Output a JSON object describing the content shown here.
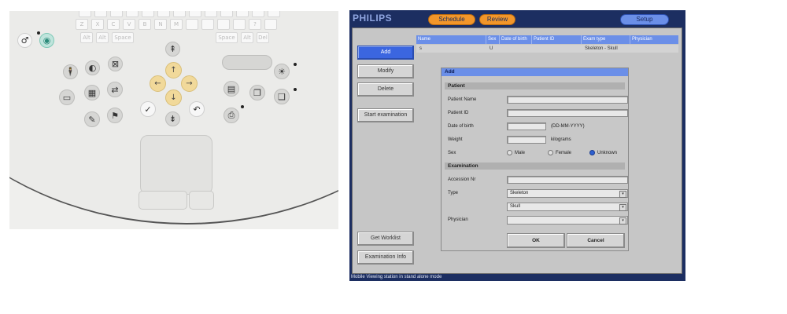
{
  "photo": {
    "keyboard_row1": [
      "",
      "",
      "",
      "",
      "",
      "",
      "",
      "",
      "",
      "",
      "",
      "",
      ""
    ],
    "keyboard_row2": [
      "Z",
      "X",
      "C",
      "V",
      "B",
      "N",
      "M",
      "",
      "",
      "",
      "",
      "?",
      ""
    ],
    "keyboard_row3": [
      "Alt",
      "Alt",
      "Space",
      "",
      "",
      "",
      "",
      "",
      "Space",
      "Alt",
      "Del"
    ]
  },
  "app": {
    "brand": "PHILIPS",
    "tabs": {
      "schedule": "Schedule",
      "review": "Review",
      "setup": "Setup"
    },
    "sidebar": {
      "add": "Add",
      "modify": "Modify",
      "delete": "Delete",
      "start_examination": "Start examination",
      "get_worklist": "Get Worklist",
      "examination_info": "Examination Info"
    },
    "table": {
      "headers": [
        "Name",
        "Sex",
        "Date of birth",
        "Patient ID",
        "Exam type",
        "Physician"
      ],
      "row": [
        "s",
        "U",
        "",
        "",
        "Skeleton - Skull",
        ""
      ]
    },
    "dialog": {
      "title": "Add",
      "patient_section": "Patient",
      "patient_name_label": "Patient Name",
      "patient_id_label": "Patient ID",
      "dob_label": "Date of birth",
      "dob_hint": "(DD-MM-YYYY)",
      "weight_label": "Weight",
      "weight_unit": "kilograms",
      "sex_label": "Sex",
      "sex_options": [
        "Male",
        "Female",
        "Unknown"
      ],
      "sex_selected": "Unknown",
      "exam_section": "Examination",
      "accession_label": "Accession Nr",
      "type_label": "Type",
      "type_value": "Skeleton",
      "subtype_value": "Skull",
      "physician_label": "Physician",
      "physician_value": "",
      "ok": "OK",
      "cancel": "Cancel"
    },
    "status": "Mobile Viewing station in stand alone mode"
  }
}
